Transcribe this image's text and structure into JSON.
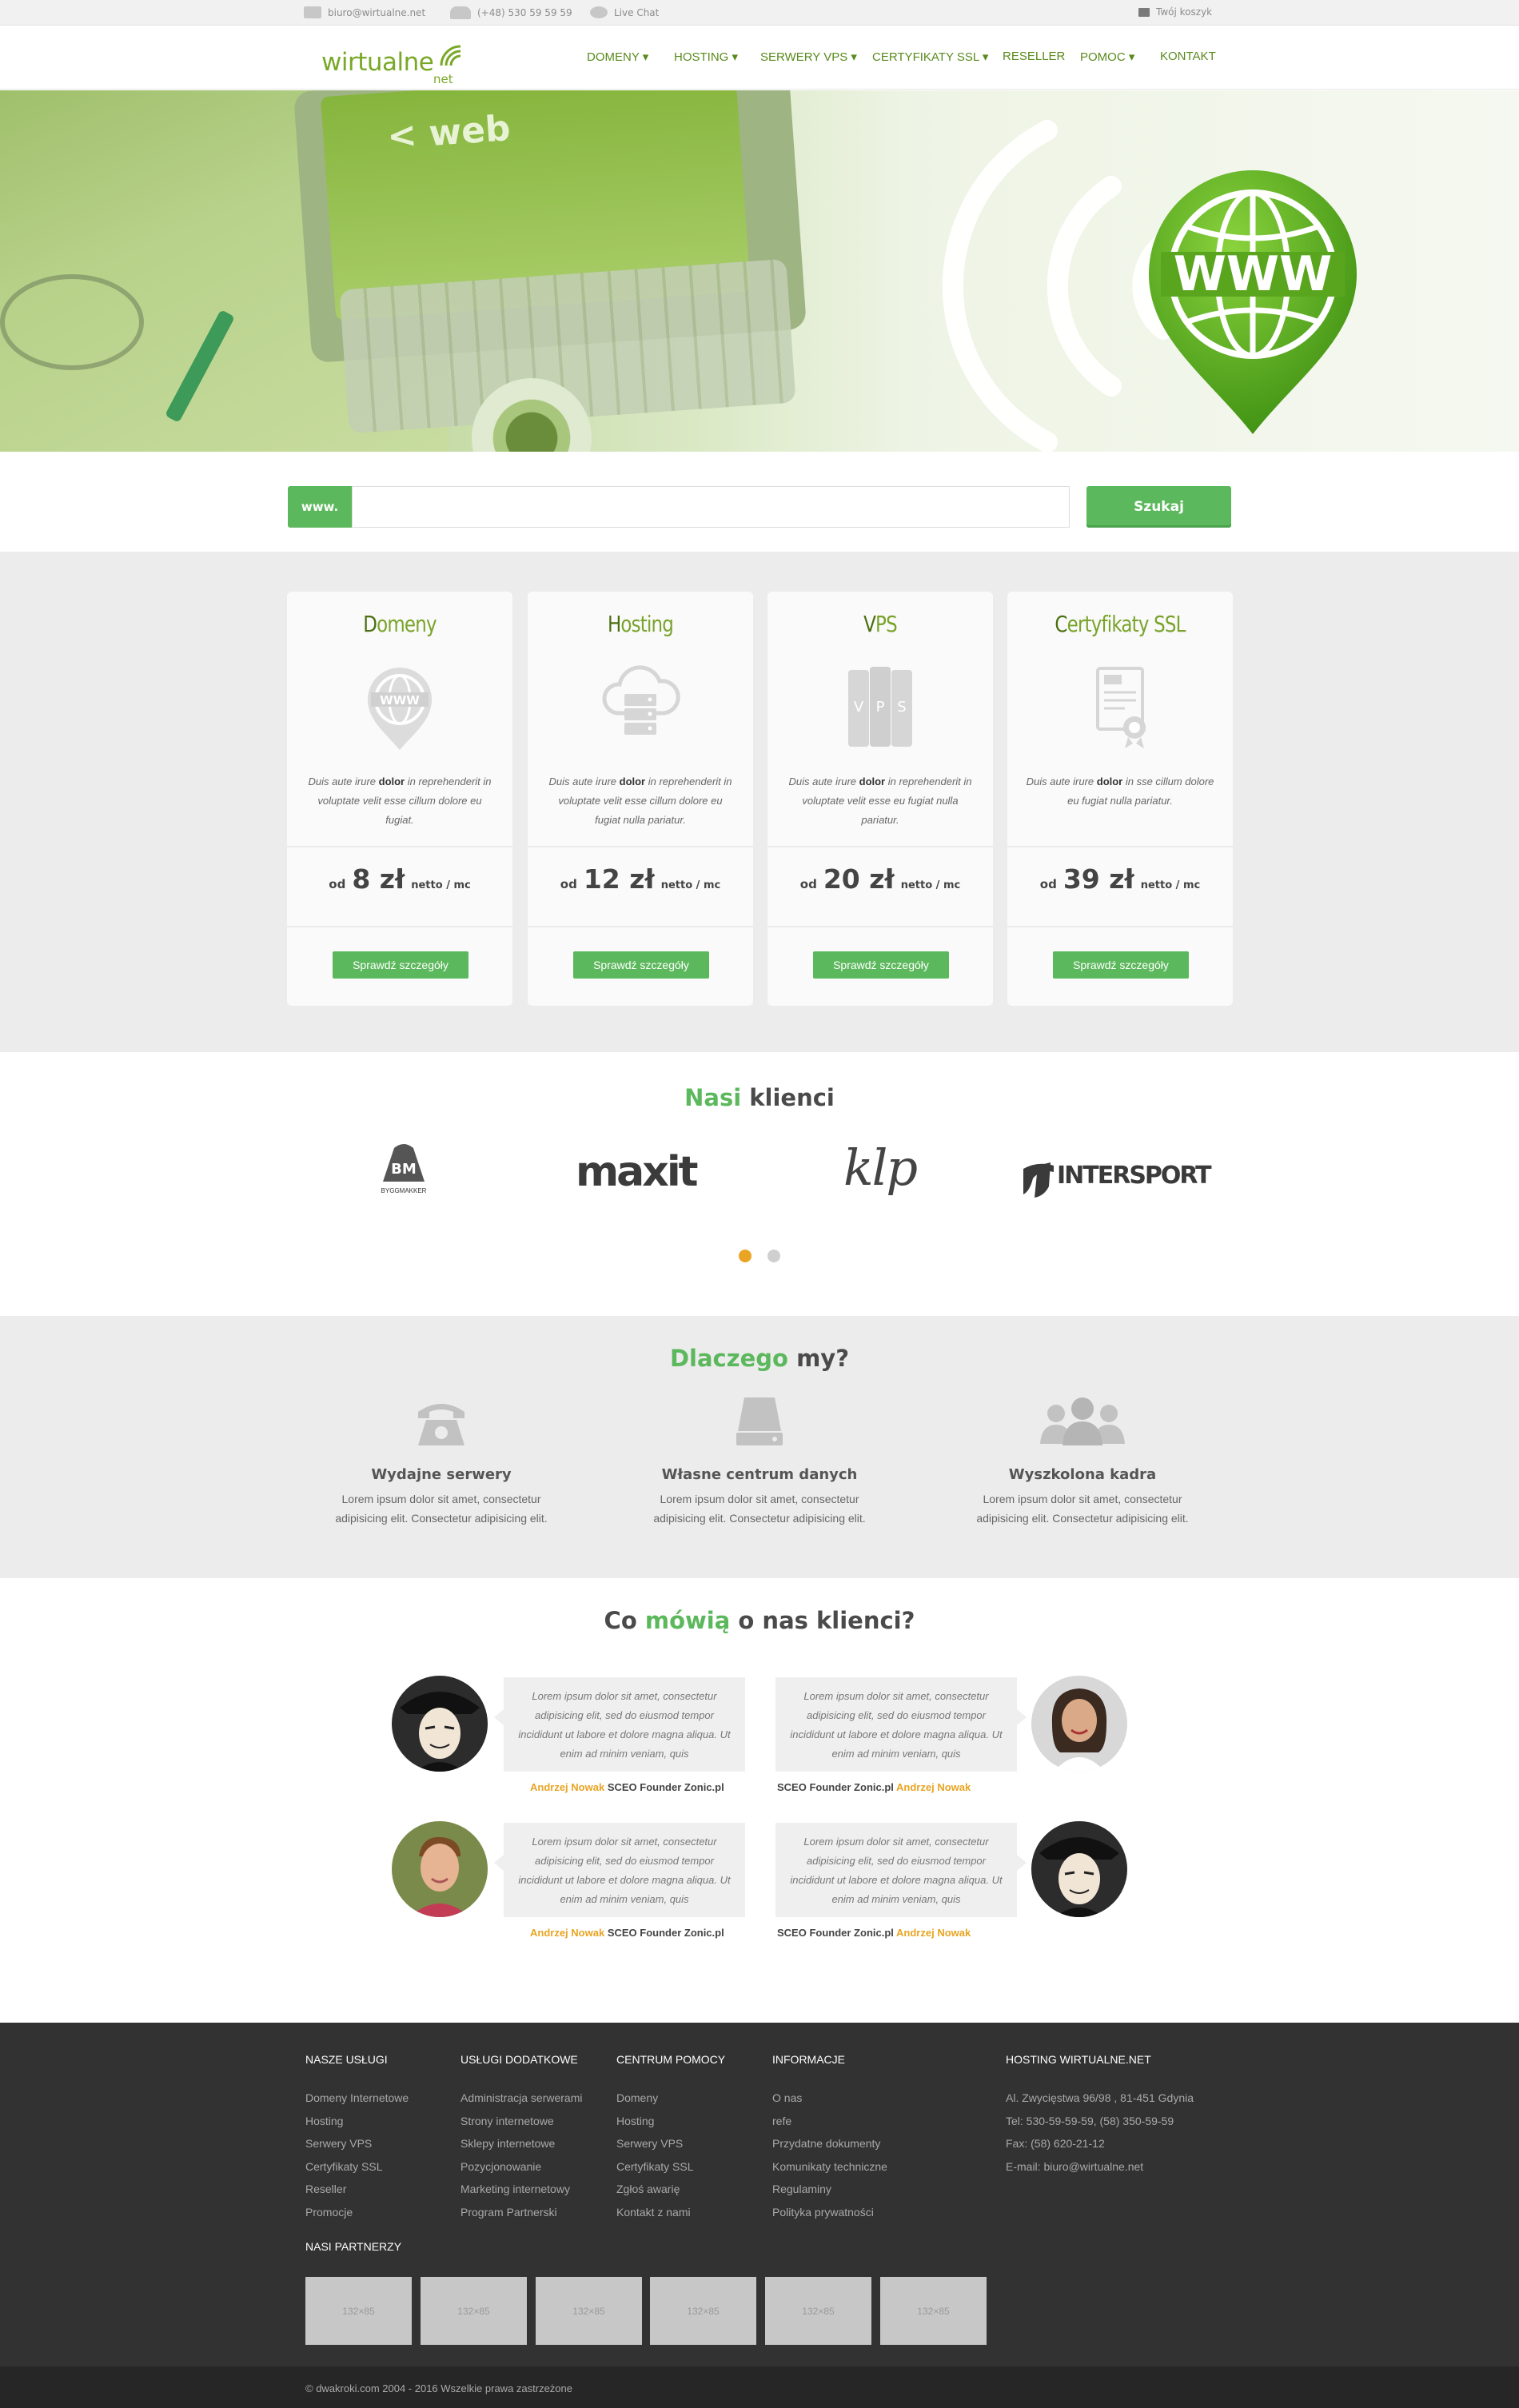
{
  "topbar": {
    "email": "biuro@wirtualne.net",
    "phone": "(+48) 530 59 59 59",
    "chat": "Live Chat",
    "cart": "Twój koszyk"
  },
  "header": {
    "logo_main": "wirtualne",
    "logo_sub": "net",
    "nav": [
      {
        "label": "DOMENY",
        "dropdown": true
      },
      {
        "label": "HOSTING",
        "dropdown": true
      },
      {
        "label": "SERWERY VPS",
        "dropdown": true
      },
      {
        "label": "CERTYFIKATY SSL",
        "dropdown": true
      },
      {
        "label": "RESELLER",
        "dropdown": false
      },
      {
        "label": "POMOC",
        "dropdown": true
      },
      {
        "label": "KONTAKT",
        "dropdown": false
      }
    ]
  },
  "hero": {
    "pin_text": "WWW",
    "screen_text": "< web"
  },
  "search": {
    "prefix": "www.",
    "value": "",
    "button": "Szukaj"
  },
  "offers": [
    {
      "title_first": "D",
      "title_rest": "omeny",
      "icon": "www-pin-icon",
      "desc_pre": "Duis aute irure ",
      "desc_bold": "dolor",
      "desc_post": " in reprehenderit in voluptate velit esse cillum dolore eu fugiat.",
      "od": "od",
      "price": "8 zł",
      "per": "netto / mc",
      "button": "Sprawdź szczegóły"
    },
    {
      "title_first": "H",
      "title_rest": "osting",
      "icon": "cloud-server-icon",
      "desc_pre": "Duis aute irure ",
      "desc_bold": "dolor",
      "desc_post": " in reprehenderit in voluptate velit esse cillum dolore eu fugiat nulla pariatur.",
      "od": "od",
      "price": "12 zł",
      "per": "netto / mc",
      "button": "Sprawdź szczegóły"
    },
    {
      "title_first": "V",
      "title_rest": "PS",
      "icon": "vps-server-icon",
      "desc_pre": "Duis aute irure ",
      "desc_bold": "dolor",
      "desc_post": " in reprehenderit in voluptate velit esse eu fugiat nulla pariatur.",
      "od": "od",
      "price": "20 zł",
      "per": "netto / mc",
      "button": "Sprawdź szczegóły"
    },
    {
      "title_first": "C",
      "title_rest": "ertyfikaty SSL",
      "icon": "ssl-certificate-icon",
      "desc_pre": "Duis aute irure ",
      "desc_bold": "dolor",
      "desc_post": " in sse cillum dolore eu fugiat nulla pariatur.",
      "od": "od",
      "price": "39 zł",
      "per": "netto / mc",
      "button": "Sprawdź szczegóły"
    }
  ],
  "clients": {
    "title_green": "Nasi",
    "title_rest": " klienci",
    "logos": [
      "BM",
      "BYGGMAKKER",
      "maxit",
      "klp",
      "INTERSPORT"
    ],
    "slider_active": 1,
    "slider_count": 2
  },
  "why": {
    "title_green": "Dlaczego",
    "title_rest": " my?",
    "features": [
      {
        "icon": "telephone-icon",
        "title": "Wydajne serwery",
        "text": "Lorem ipsum dolor sit amet, consectetur adipisicing elit. Consectetur adipisicing elit."
      },
      {
        "icon": "hard-drive-icon",
        "title": "Własne centrum danych",
        "text": "Lorem ipsum dolor sit amet, consectetur adipisicing elit. Consectetur adipisicing elit."
      },
      {
        "icon": "team-icon",
        "title": "Wyszkolona kadra",
        "text": "Lorem ipsum dolor sit amet, consectetur adipisicing elit. Consectetur adipisicing elit."
      }
    ]
  },
  "testimonials": {
    "title_a": "Co ",
    "title_green": "mówią",
    "title_rest": " o nas klienci?",
    "items": [
      {
        "text": "Lorem ipsum dolor sit amet, consectetur adipisicing elit, sed do eiusmod tempor incididunt ut labore et dolore magna aliqua. Ut enim ad minim veniam, quis",
        "name": "Andrzej Nowak",
        "company": "SCEO Founder Zonic.pl"
      },
      {
        "text": "Lorem ipsum dolor sit amet, consectetur adipisicing elit, sed do eiusmod tempor incididunt ut labore et dolore magna aliqua. Ut enim ad minim veniam, quis",
        "name": "Andrzej Nowak",
        "company": "SCEO Founder Zonic.pl"
      },
      {
        "text": "Lorem ipsum dolor sit amet, consectetur adipisicing elit, sed do eiusmod tempor incididunt ut labore et dolore magna aliqua. Ut enim ad minim veniam, quis",
        "name": "Andrzej Nowak",
        "company": "SCEO Founder Zonic.pl"
      },
      {
        "text": "Lorem ipsum dolor sit amet, consectetur adipisicing elit, sed do eiusmod tempor incididunt ut labore et dolore magna aliqua. Ut enim ad minim veniam, quis",
        "name": "Andrzej Nowak",
        "company": "SCEO Founder Zonic.pl"
      }
    ]
  },
  "footer": {
    "columns": [
      {
        "heading": "NASZE USŁUGI",
        "links": [
          "Domeny Internetowe",
          "Hosting",
          "Serwery VPS",
          "Certyfikaty SSL",
          "Reseller",
          "Promocje"
        ]
      },
      {
        "heading": "USŁUGI DODATKOWE",
        "links": [
          "Administracja serwerami",
          "Strony internetowe",
          "Sklepy internetowe",
          "Pozycjonowanie",
          "Marketing internetowy",
          "Program Partnerski"
        ]
      },
      {
        "heading": "CENTRUM POMOCY",
        "links": [
          "Domeny",
          "Hosting",
          "Serwery VPS",
          "Certyfikaty SSL",
          "Zgłoś awarię",
          "Kontakt z nami"
        ]
      },
      {
        "heading": "INFORMACJE",
        "links": [
          "O nas",
          "refe",
          "Przydatne dokumenty",
          "Komunikaty techniczne",
          "Regulaminy",
          "Polityka prywatności"
        ]
      },
      {
        "heading": "HOSTING WIRTUALNE.NET",
        "links": [
          "Al. Zwycięstwa 96/98 , 81-451 Gdynia",
          "Tel: 530-59-59-59, (58) 350-59-59",
          "Fax: (58) 620-21-12",
          "E-mail: biuro@wirtualne.net"
        ]
      }
    ],
    "partners_heading": "NASI PARTNERZY",
    "partners": [
      "132×85",
      "132×85",
      "132×85",
      "132×85",
      "132×85",
      "132×85"
    ],
    "copyright": "© dwakroki.com 2004 - 2016 Wszelkie prawa zastrzeżone"
  },
  "colors": {
    "accent": "#5cb85c",
    "brand_green": "#79a827",
    "author_orange": "#e9a423",
    "footer_bg": "#323232"
  }
}
